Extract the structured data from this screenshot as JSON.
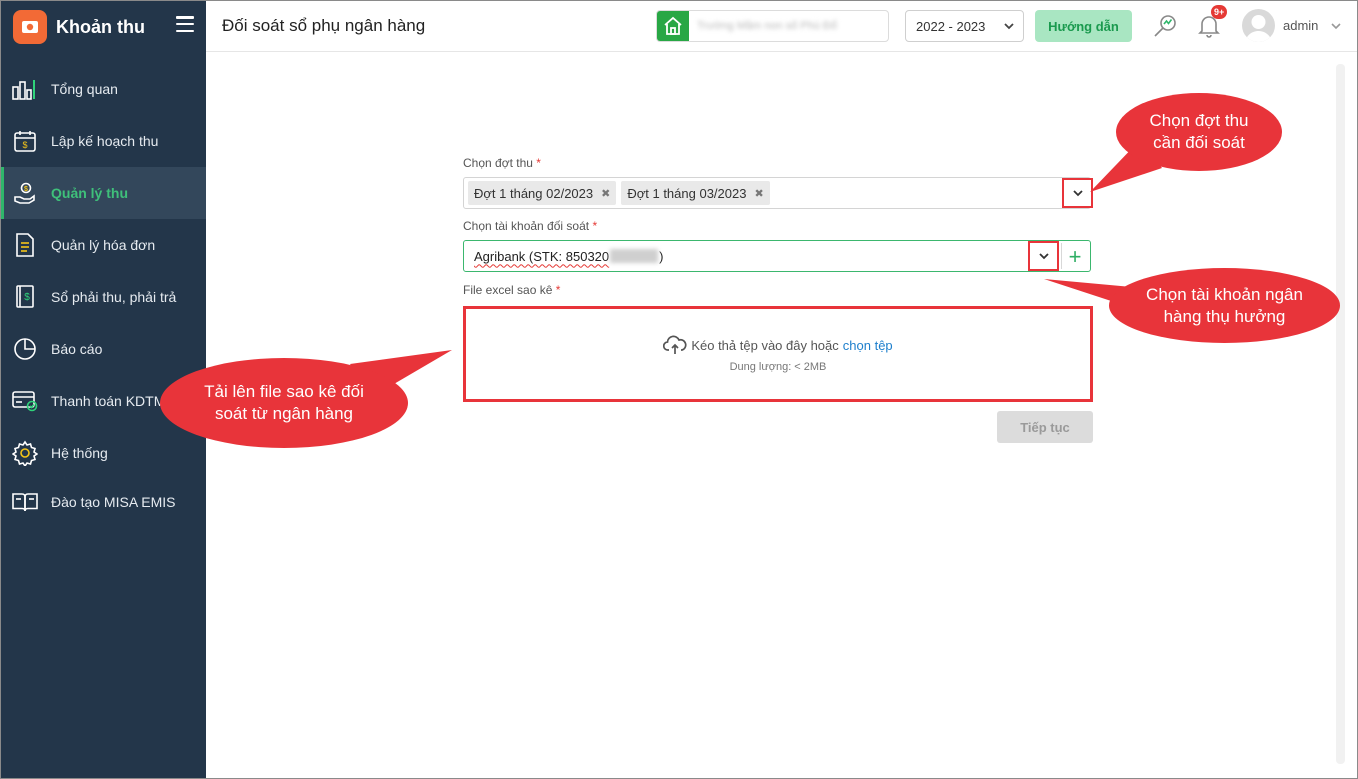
{
  "app": {
    "title": "Khoản thu"
  },
  "sidebar": {
    "items": [
      {
        "label": "Tổng quan",
        "icon": "bar-chart-icon"
      },
      {
        "label": "Lập kế hoạch thu",
        "icon": "calendar-money-icon"
      },
      {
        "label": "Quản lý thu",
        "icon": "hand-coin-icon",
        "active": true
      },
      {
        "label": "Quản lý hóa đơn",
        "icon": "document-icon"
      },
      {
        "label": "Sổ phải thu, phải trả",
        "icon": "ledger-icon"
      },
      {
        "label": "Báo cáo",
        "icon": "pie-chart-icon"
      },
      {
        "label": "Thanh toán KDTM",
        "icon": "card-payment-icon"
      },
      {
        "label": "Hệ thống",
        "icon": "gear-icon"
      },
      {
        "label": "Đào tạo MISA EMIS",
        "icon": "book-icon"
      }
    ]
  },
  "header": {
    "page_title": "Đối soát sổ phụ ngân hàng",
    "school_name": "Trường Mầm non số Phù Đổ",
    "year": "2022 - 2023",
    "guide_label": "Hướng dẫn",
    "notification_badge": "9+",
    "user": "admin"
  },
  "form": {
    "batch_label": "Chọn đợt thu",
    "batch_chips": [
      "Đợt 1 tháng 02/2023",
      "Đợt 1 tháng 03/2023"
    ],
    "account_label": "Chọn tài khoản đối soát",
    "account_prefix": "Agribank (STK: 850320",
    "account_suffix": ")",
    "file_label": "File excel sao kê",
    "required_mark": "*",
    "dropzone_text": "Kéo thả tệp vào đây hoặc",
    "dropzone_link": "chọn tệp",
    "dropzone_limit": "Dung lượng: < 2MB",
    "continue_label": "Tiếp tục"
  },
  "callouts": {
    "batch": "Chọn đợt thu cần đối soát",
    "account": "Chọn tài khoản ngân hàng thụ hưởng",
    "upload": "Tải lên file sao kê đối soát từ ngân hàng"
  },
  "colors": {
    "sidebar_bg": "#23364a",
    "active_green": "#3fc07a",
    "callout_red": "#e8343a",
    "brand_orange": "#f26a36"
  }
}
